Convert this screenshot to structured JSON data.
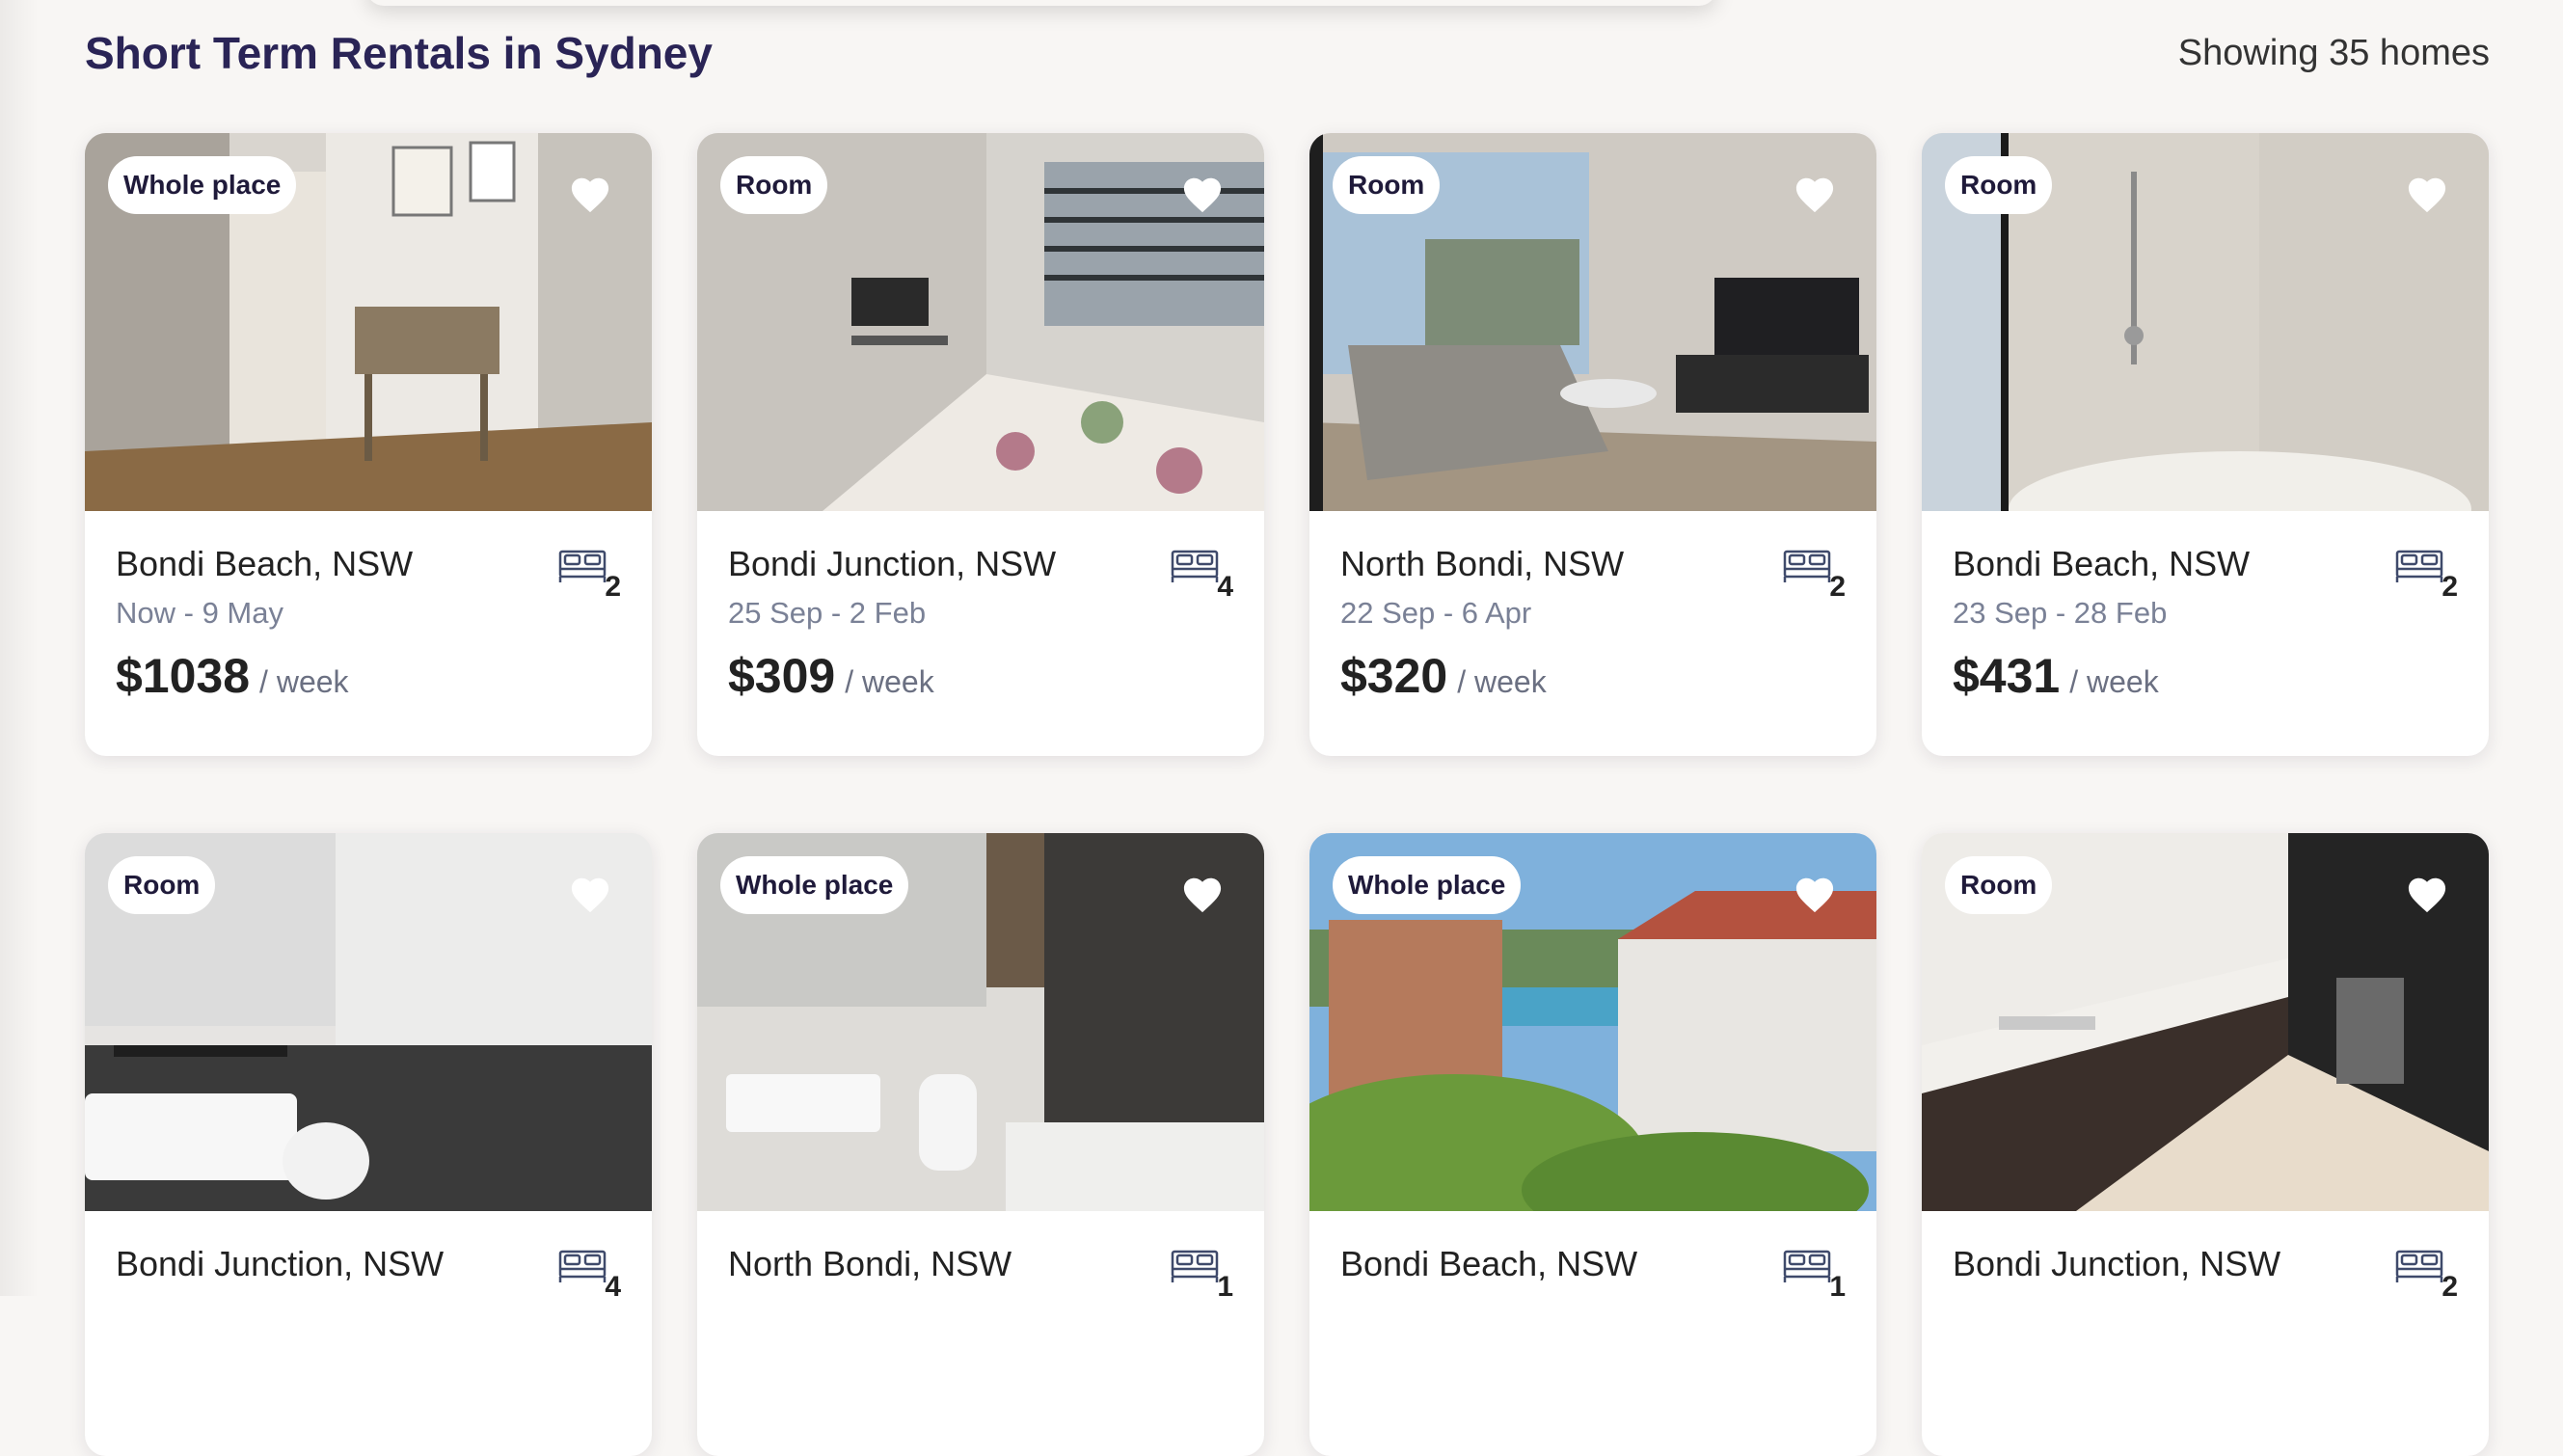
{
  "header": {
    "title": "Short Term Rentals in Sydney",
    "count": "Showing 35 homes"
  },
  "listings": [
    {
      "type": "Whole place",
      "location": "Bondi Beach, NSW",
      "dates": "Now - 9 May",
      "price": "$1038",
      "per": "/ week",
      "beds": "2"
    },
    {
      "type": "Room",
      "location": "Bondi Junction, NSW",
      "dates": "25 Sep - 2 Feb",
      "price": "$309",
      "per": "/ week",
      "beds": "4"
    },
    {
      "type": "Room",
      "location": "North Bondi, NSW",
      "dates": "22 Sep - 6 Apr",
      "price": "$320",
      "per": "/ week",
      "beds": "2"
    },
    {
      "type": "Room",
      "location": "Bondi Beach, NSW",
      "dates": "23 Sep - 28 Feb",
      "price": "$431",
      "per": "/ week",
      "beds": "2"
    },
    {
      "type": "Room",
      "location": "Bondi Junction, NSW",
      "beds": "4"
    },
    {
      "type": "Whole place",
      "location": "North Bondi, NSW",
      "beds": "1"
    },
    {
      "type": "Whole place",
      "location": "Bondi Beach, NSW",
      "beds": "1"
    },
    {
      "type": "Room",
      "location": "Bondi Junction, NSW",
      "beds": "2"
    }
  ],
  "icons": {
    "favorite": "heart-icon",
    "beds": "bed-icon"
  }
}
